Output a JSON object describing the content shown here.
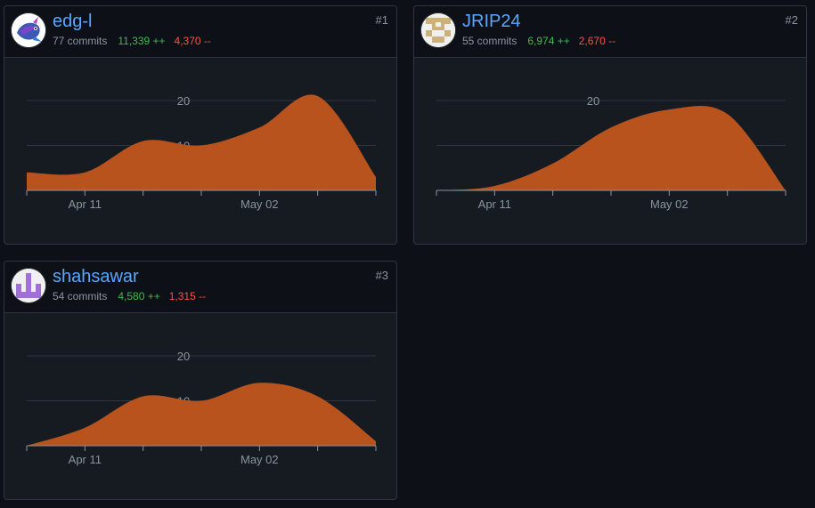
{
  "accent": "#b9531d",
  "cards": [
    {
      "user": "edg-l",
      "commits": "77 commits",
      "additions": "11,339 ++",
      "deletions": "4,370 --",
      "rank": "#1",
      "avatar_icon": "fish-avatar-icon"
    },
    {
      "user": "JRIP24",
      "commits": "55 commits",
      "additions": "6,974 ++",
      "deletions": "2,670 --",
      "rank": "#2",
      "avatar_icon": "identicon-avatar-icon"
    },
    {
      "user": "shahsawar",
      "commits": "54 commits",
      "additions": "4,580 ++",
      "deletions": "1,315 --",
      "rank": "#3",
      "avatar_icon": "identicon-avatar-icon"
    }
  ],
  "chart_data": [
    {
      "type": "area",
      "ylim": [
        0,
        20
      ],
      "y_ticks": [
        "10",
        "20"
      ],
      "x_ticks": [
        "Apr 11",
        "May 02"
      ],
      "x": [
        0,
        1,
        2,
        3,
        4,
        5,
        6
      ],
      "values": [
        4,
        4,
        11,
        10,
        14,
        21,
        3
      ],
      "color": "#b9531d"
    },
    {
      "type": "area",
      "ylim": [
        0,
        20
      ],
      "y_ticks": [
        "10",
        "20"
      ],
      "x_ticks": [
        "Apr 11",
        "May 02"
      ],
      "x": [
        0,
        1,
        2,
        3,
        4,
        5,
        6
      ],
      "values": [
        0,
        1,
        6,
        14,
        18,
        17,
        0
      ],
      "color": "#b9531d"
    },
    {
      "type": "area",
      "ylim": [
        0,
        20
      ],
      "y_ticks": [
        "10",
        "20"
      ],
      "x_ticks": [
        "Apr 11",
        "May 02"
      ],
      "x": [
        0,
        1,
        2,
        3,
        4,
        5,
        6
      ],
      "values": [
        0,
        4,
        11,
        10,
        14,
        11,
        1
      ],
      "color": "#b9531d"
    }
  ]
}
